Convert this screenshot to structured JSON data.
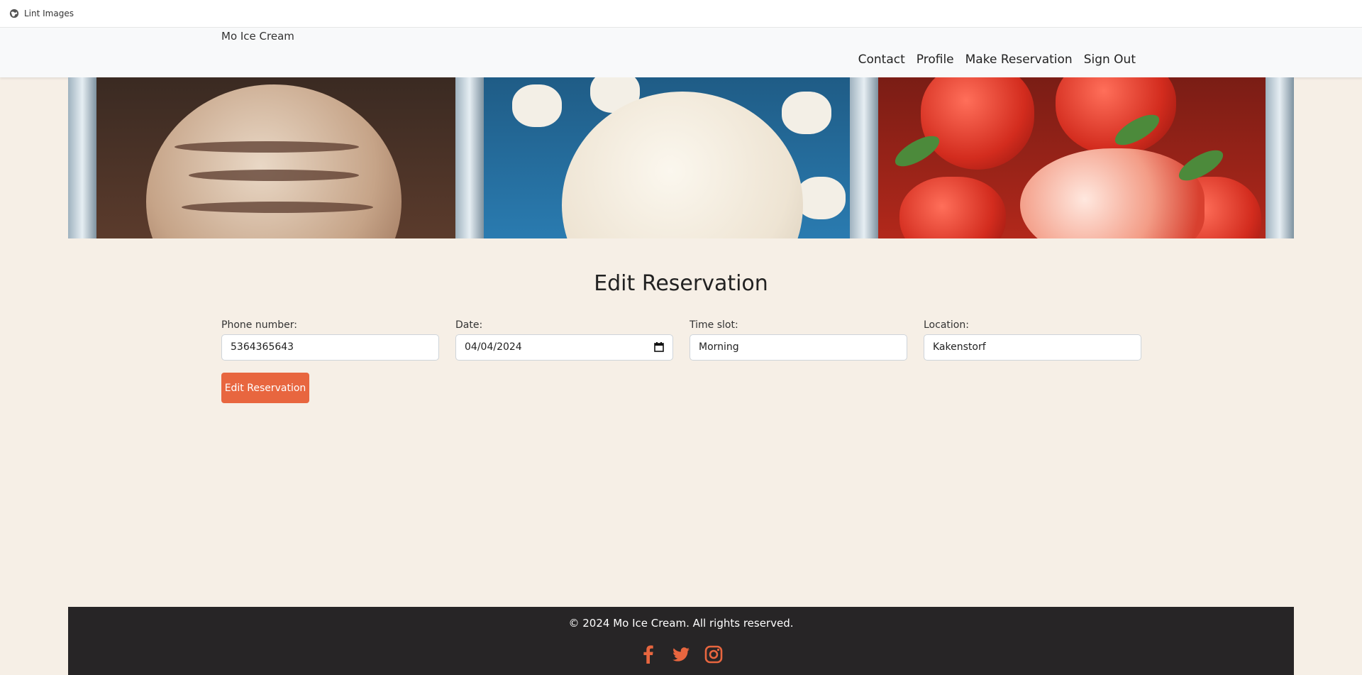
{
  "browser": {
    "title": "Lint Images"
  },
  "navbar": {
    "brand": "Mo Ice Cream",
    "links": [
      "Contact",
      "Profile",
      "Make Reservation",
      "Sign Out"
    ]
  },
  "main": {
    "title": "Edit Reservation",
    "fields": [
      {
        "label": "Phone number:",
        "value": "5364365643"
      },
      {
        "label": "Date:",
        "value": "04/04/2024"
      },
      {
        "label": "Time slot:",
        "value": "Morning"
      },
      {
        "label": "Location:",
        "value": "Kakenstorf"
      }
    ],
    "submit_label": "Edit Reservation"
  },
  "footer": {
    "copyright": "© 2024 Mo Ice Cream. All rights reserved.",
    "social_icons": [
      "facebook-icon",
      "twitter-icon",
      "instagram-icon"
    ]
  },
  "colors": {
    "accent": "#e8663f",
    "background": "#f6efe6",
    "footer": "#272526"
  }
}
